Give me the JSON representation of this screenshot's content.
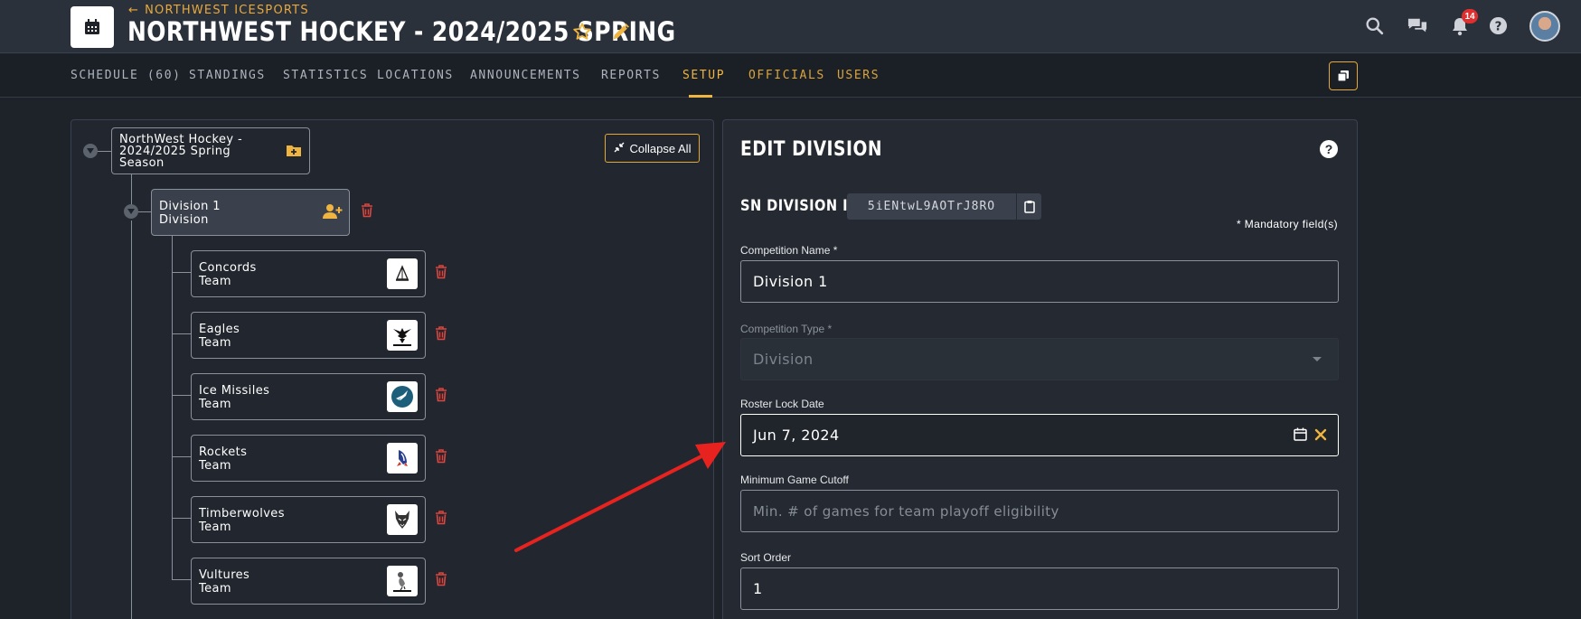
{
  "header": {
    "back_link": "NORTHWEST ICESPORTS",
    "title": "NORTHWEST HOCKEY - 2024/2025 SPRING",
    "notifications_count": "14"
  },
  "nav": {
    "tabs": [
      {
        "label": "SCHEDULE (60)"
      },
      {
        "label": "STANDINGS"
      },
      {
        "label": "STATISTICS"
      },
      {
        "label": "LOCATIONS"
      },
      {
        "label": "ANNOUNCEMENTS"
      },
      {
        "label": "REPORTS"
      },
      {
        "label": "SETUP",
        "active": true
      },
      {
        "label": "OFFICIALS"
      },
      {
        "label": "USERS"
      }
    ]
  },
  "tree": {
    "collapse_label": "Collapse All",
    "root": {
      "name_line1": "NorthWest Hockey -",
      "name_line2": "2024/2025 Spring",
      "name_line3": "Season"
    },
    "division": {
      "name": "Division 1",
      "type": "Division"
    },
    "teams": [
      {
        "name": "Concords",
        "type": "Team",
        "logo": "sailboat-logo-icon"
      },
      {
        "name": "Eagles",
        "type": "Team",
        "logo": "eagle-logo-icon"
      },
      {
        "name": "Ice Missiles",
        "type": "Team",
        "logo": "missile-logo-icon"
      },
      {
        "name": "Rockets",
        "type": "Team",
        "logo": "rocket-logo-icon"
      },
      {
        "name": "Timberwolves",
        "type": "Team",
        "logo": "wolf-logo-icon"
      },
      {
        "name": "Vultures",
        "type": "Team",
        "logo": "vulture-logo-icon"
      }
    ]
  },
  "edit": {
    "title": "EDIT DIVISION",
    "sn_label": "SN DIVISION ID:",
    "sn_value": "5iENtwL9AOTrJ8RO",
    "mandatory_note": "* Mandatory field(s)",
    "fields": {
      "competition_name": {
        "label": "Competition Name *",
        "value": "Division 1"
      },
      "competition_type": {
        "label": "Competition Type *",
        "value": "Division"
      },
      "roster_lock": {
        "label": "Roster Lock Date",
        "value": "Jun 7, 2024"
      },
      "min_game_cutoff": {
        "label": "Minimum Game Cutoff",
        "placeholder": "Min. # of games for team playoff eligibility"
      },
      "sort_order": {
        "label": "Sort Order",
        "value": "1"
      }
    }
  },
  "colors": {
    "accent": "#f0b440",
    "danger": "#e0443c",
    "arrow": "#e8231f"
  }
}
